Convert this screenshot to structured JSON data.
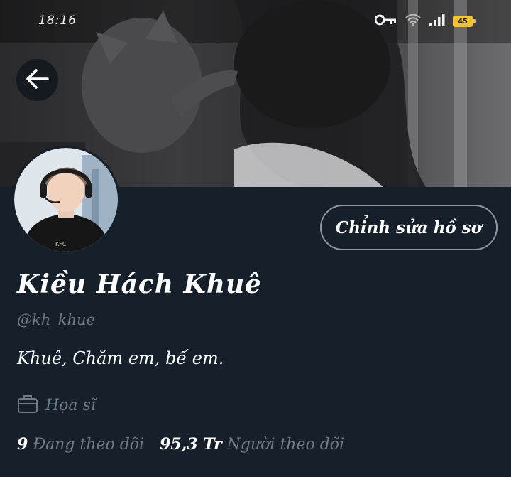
{
  "status_bar": {
    "time": "18:16",
    "battery_level": "45",
    "icons": [
      "key-icon",
      "wifi-icon",
      "signal-icon",
      "battery-icon"
    ]
  },
  "navigation": {
    "back_icon": "arrow-left-icon"
  },
  "profile": {
    "edit_button_label": "Chỉnh sửa hồ sơ",
    "display_name": "Kiều Hách Khuê",
    "handle": "@kh_khue",
    "bio": "Khuê, Chăm em, bế em.",
    "occupation": "Họa sĩ",
    "occupation_icon": "briefcase-icon",
    "following_count": "9",
    "following_label": "Đang theo dõi",
    "followers_count": "95,3 Tr",
    "followers_label": "Người theo dõi"
  },
  "colors": {
    "background": "#15202b",
    "primary_text": "#ffffff",
    "secondary_text": "#6e7b88",
    "button_border": "#8b98a5",
    "battery": "#f4c430"
  }
}
